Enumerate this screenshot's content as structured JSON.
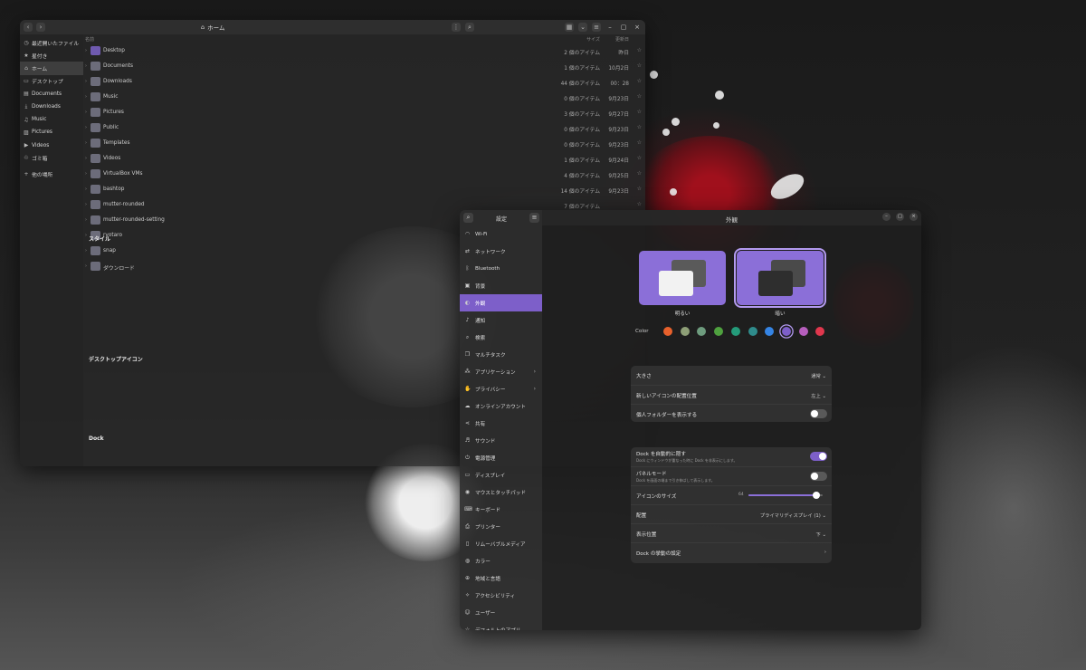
{
  "file_manager": {
    "path_label": "ホーム",
    "columns": {
      "name": "名前",
      "size": "サイズ",
      "modified": "更新日"
    },
    "sidebar": [
      {
        "icon": "clock-icon",
        "glyph": "◷",
        "label": "最近開いたファイル"
      },
      {
        "icon": "star-icon",
        "glyph": "★",
        "label": "星付き"
      },
      {
        "icon": "home-icon",
        "glyph": "⌂",
        "label": "ホーム",
        "active": true
      },
      {
        "icon": "desktop-icon",
        "glyph": "▭",
        "label": "デスクトップ"
      },
      {
        "icon": "document-icon",
        "glyph": "▤",
        "label": "Documents"
      },
      {
        "icon": "download-icon",
        "glyph": "⤓",
        "label": "Downloads"
      },
      {
        "icon": "music-icon",
        "glyph": "♫",
        "label": "Music"
      },
      {
        "icon": "picture-icon",
        "glyph": "▨",
        "label": "Pictures"
      },
      {
        "icon": "video-icon",
        "glyph": "▶",
        "label": "Videos"
      },
      {
        "icon": "trash-icon",
        "glyph": "♲",
        "label": "ゴミ箱"
      },
      {
        "icon": "plus-icon",
        "glyph": "+",
        "label": "他の場所"
      }
    ],
    "rows": [
      {
        "name": "Desktop",
        "size": "2 個のアイテム",
        "modified": "昨日",
        "desk": true
      },
      {
        "name": "Documents",
        "size": "1 個のアイテム",
        "modified": "10月2日"
      },
      {
        "name": "Downloads",
        "size": "44 個のアイテム",
        "modified": "00：28"
      },
      {
        "name": "Music",
        "size": "0 個のアイテム",
        "modified": "9月23日"
      },
      {
        "name": "Pictures",
        "size": "3 個のアイテム",
        "modified": "9月27日"
      },
      {
        "name": "Public",
        "size": "0 個のアイテム",
        "modified": "9月23日"
      },
      {
        "name": "Templates",
        "size": "0 個のアイテム",
        "modified": "9月23日"
      },
      {
        "name": "Videos",
        "size": "1 個のアイテム",
        "modified": "9月24日"
      },
      {
        "name": "VirtualBox VMs",
        "size": "4 個のアイテム",
        "modified": "9月25日"
      },
      {
        "name": "bashtop",
        "size": "14 個のアイテム",
        "modified": "9月23日"
      },
      {
        "name": "mutter-rounded",
        "size": "7 個のアイテム",
        "modified": ""
      },
      {
        "name": "mutter-rounded-setting",
        "size": "",
        "modified": ""
      },
      {
        "name": "ryotaro",
        "size": "",
        "modified": ""
      },
      {
        "name": "snap",
        "size": "",
        "modified": ""
      },
      {
        "name": "ダウンロード",
        "size": "",
        "modified": ""
      }
    ]
  },
  "settings": {
    "sidebar_title": "設定",
    "window_title": "外観",
    "nav": [
      {
        "icon": "wifi-icon",
        "glyph": "◠",
        "label": "Wi-Fi"
      },
      {
        "icon": "network-icon",
        "glyph": "⇄",
        "label": "ネットワーク"
      },
      {
        "icon": "bluetooth-icon",
        "glyph": "ᛒ",
        "label": "Bluetooth"
      },
      {
        "icon": "background-icon",
        "glyph": "▣",
        "label": "背景"
      },
      {
        "icon": "appearance-icon",
        "glyph": "◐",
        "label": "外観",
        "active": true
      },
      {
        "icon": "bell-icon",
        "glyph": "♪",
        "label": "通知"
      },
      {
        "icon": "search-icon",
        "glyph": "⌕",
        "label": "検索"
      },
      {
        "icon": "multitask-icon",
        "glyph": "❐",
        "label": "マルチタスク"
      },
      {
        "icon": "apps-icon",
        "glyph": "⁂",
        "label": "アプリケーション",
        "chevron": true
      },
      {
        "icon": "hand-icon",
        "glyph": "✋",
        "label": "プライバシー",
        "chevron": true
      },
      {
        "icon": "cloud-icon",
        "glyph": "☁",
        "label": "オンラインアカウント"
      },
      {
        "icon": "share-icon",
        "glyph": "⋖",
        "label": "共有"
      },
      {
        "icon": "sound-icon",
        "glyph": "♬",
        "label": "サウンド"
      },
      {
        "icon": "power-icon",
        "glyph": "⏻",
        "label": "電源管理"
      },
      {
        "icon": "display-icon",
        "glyph": "▭",
        "label": "ディスプレイ"
      },
      {
        "icon": "mouse-icon",
        "glyph": "◉",
        "label": "マウスとタッチパッド"
      },
      {
        "icon": "keyboard-icon",
        "glyph": "⌨",
        "label": "キーボード"
      },
      {
        "icon": "printer-icon",
        "glyph": "⎙",
        "label": "プリンター"
      },
      {
        "icon": "usb-icon",
        "glyph": "▯",
        "label": "リムーバブルメディア"
      },
      {
        "icon": "color-icon",
        "glyph": "◍",
        "label": "カラー"
      },
      {
        "icon": "globe-icon",
        "glyph": "⊕",
        "label": "地域と言語"
      },
      {
        "icon": "accessibility-icon",
        "glyph": "✧",
        "label": "アクセシビリティ"
      },
      {
        "icon": "user-icon",
        "glyph": "☺",
        "label": "ユーザー"
      },
      {
        "icon": "star-icon",
        "glyph": "☆",
        "label": "デフォルトのアプリ"
      }
    ],
    "style": {
      "heading": "スタイル",
      "light_label": "明るい",
      "dark_label": "暗い",
      "selected": "dark",
      "color_label": "Color",
      "colors": [
        "#e8612c",
        "#8e9f77",
        "#6e9c7e",
        "#4fa13f",
        "#249b7a",
        "#2f8c8c",
        "#3584e4",
        "#7d5fc9",
        "#b65fbd",
        "#e0374d"
      ],
      "selected_color": "#7d5fc9"
    },
    "desktop_icons": {
      "heading": "デスクトップアイコン",
      "size_label": "大きさ",
      "size_value": "通常",
      "position_label": "新しいアイコンの配置位置",
      "position_value": "左上",
      "personal_folder_label": "個人フォルダーを表示する",
      "personal_folder_on": false
    },
    "dock": {
      "heading": "Dock",
      "autohide_label": "Dock を自動的に隠す",
      "autohide_sub": "Dock にウィンドウが重なった時に Dock を非表示にします。",
      "autohide_on": true,
      "panel_label": "パネルモード",
      "panel_sub": "Dock を画面の端まで引き伸ばして表示します。",
      "panel_on": false,
      "icon_size_label": "アイコンのサイズ",
      "icon_size_value": "64",
      "icon_size_fraction": 0.92,
      "placement_label": "配置",
      "placement_value": "プライマリディスプレイ (1)",
      "position_label": "表示位置",
      "position_value": "下",
      "behavior_label": "Dock の挙動の設定"
    }
  }
}
